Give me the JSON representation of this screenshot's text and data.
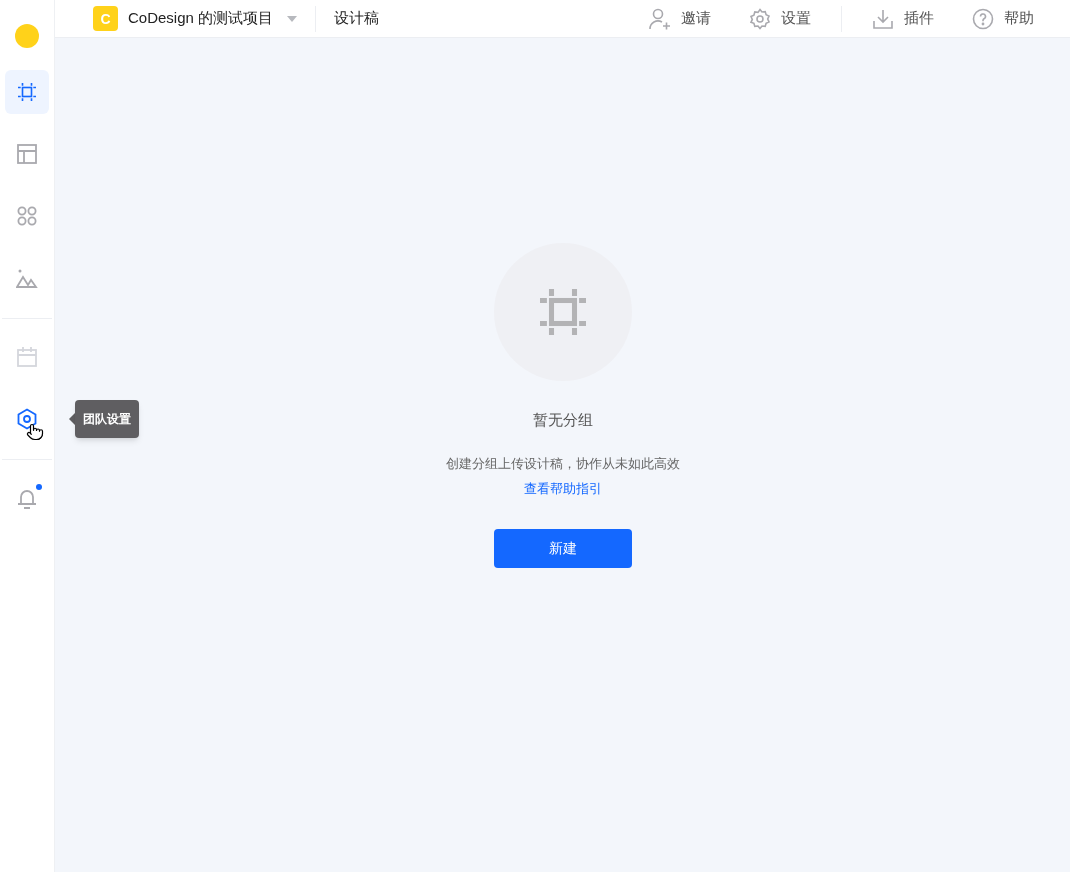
{
  "project": {
    "initial": "C",
    "name": "CoDesign 的测试项目"
  },
  "section_title": "设计稿",
  "actions": [
    {
      "kind": "invite",
      "label": "邀请"
    },
    {
      "kind": "settings",
      "label": "设置"
    },
    {
      "kind": "plugins",
      "label": "插件"
    },
    {
      "kind": "help",
      "label": "帮助"
    }
  ],
  "sidebar": {
    "groups": [
      [
        {
          "kind": "artboard",
          "selected": true,
          "disabled": false,
          "hovered": false
        },
        {
          "kind": "layout",
          "selected": false,
          "disabled": false,
          "hovered": false
        },
        {
          "kind": "components",
          "selected": false,
          "disabled": false,
          "hovered": false
        },
        {
          "kind": "images",
          "selected": false,
          "disabled": false,
          "hovered": false
        }
      ],
      [
        {
          "kind": "calendar",
          "selected": false,
          "disabled": true,
          "hovered": false
        },
        {
          "kind": "team",
          "selected": false,
          "disabled": false,
          "hovered": true,
          "tooltip": "团队设置"
        }
      ],
      [
        {
          "kind": "bell",
          "selected": false,
          "disabled": false,
          "hovered": false,
          "unread": true
        }
      ]
    ]
  },
  "empty_state": {
    "title": "暂无分组",
    "description": "创建分组上传设计稿，协作从未如此高效",
    "link": "查看帮助指引",
    "button": "新建"
  }
}
